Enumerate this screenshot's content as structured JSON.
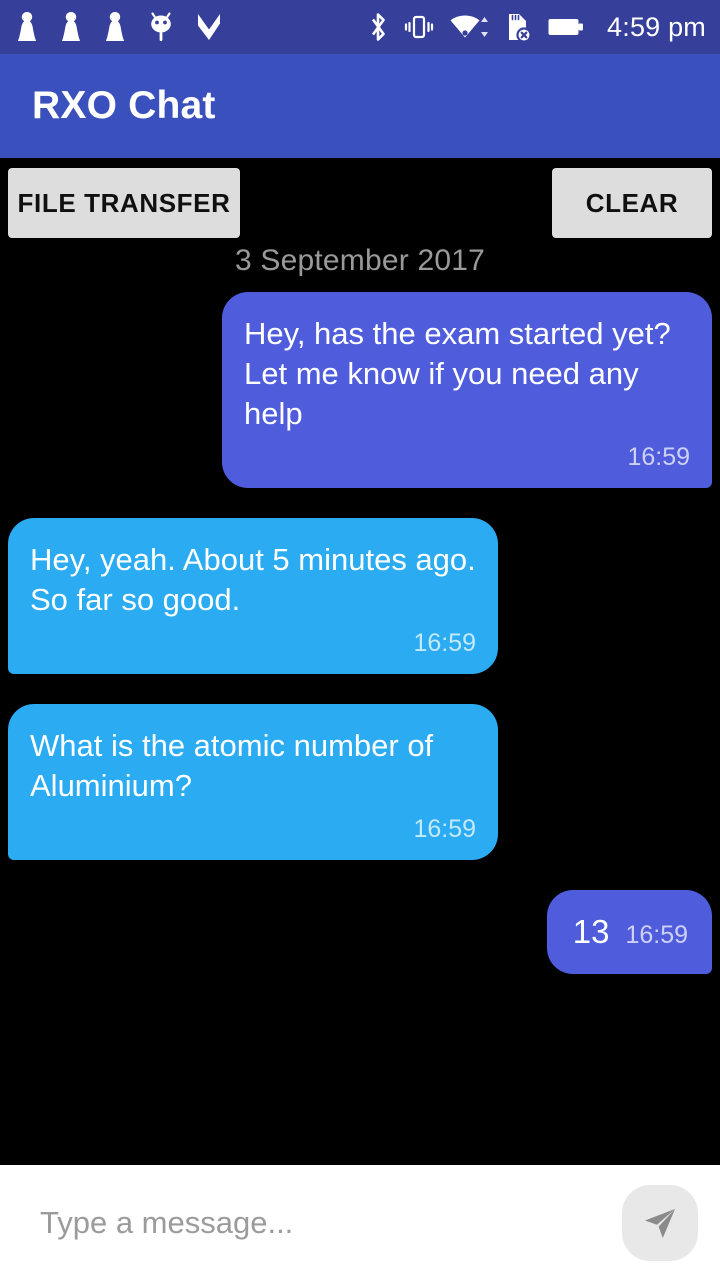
{
  "status_bar": {
    "background_color": "#36409B",
    "time": "4:59 pm",
    "left_icons": [
      {
        "name": "notification-chess-pawn-icon-1"
      },
      {
        "name": "notification-chess-pawn-icon-2"
      },
      {
        "name": "notification-chess-pawn-icon-3"
      },
      {
        "name": "android-robot-icon"
      },
      {
        "name": "check-flag-icon"
      }
    ],
    "right_icons": [
      {
        "name": "bluetooth-icon"
      },
      {
        "name": "vibrate-icon"
      },
      {
        "name": "wifi-icon"
      },
      {
        "name": "sd-card-removed-icon"
      },
      {
        "name": "battery-icon"
      }
    ]
  },
  "app_bar": {
    "title": "RXO Chat",
    "background_color": "#3A50BC"
  },
  "actions": {
    "file_transfer_label": "FILE TRANSFER",
    "clear_label": "CLEAR",
    "button_color": "#DDDDDD"
  },
  "conversation": {
    "date_divider": "3 September 2017",
    "outgoing_color": "#4F5CDC",
    "incoming_color": "#2BABF2",
    "messages": [
      {
        "direction": "out",
        "text": "Hey, has the exam started yet? Let me know if you need any help",
        "time": "16:59",
        "compact": false
      },
      {
        "direction": "in",
        "text": "Hey, yeah. About 5 minutes ago. So far so good.",
        "time": "16:59",
        "compact": false
      },
      {
        "direction": "in",
        "text": "What is the atomic number of Aluminium?",
        "time": "16:59",
        "compact": false
      },
      {
        "direction": "out",
        "text": "13",
        "time": "16:59",
        "compact": true
      }
    ]
  },
  "input_bar": {
    "placeholder": "Type a message...",
    "value": "",
    "send_icon": "send-paper-plane-icon",
    "background_color": "#FFFFFF"
  }
}
